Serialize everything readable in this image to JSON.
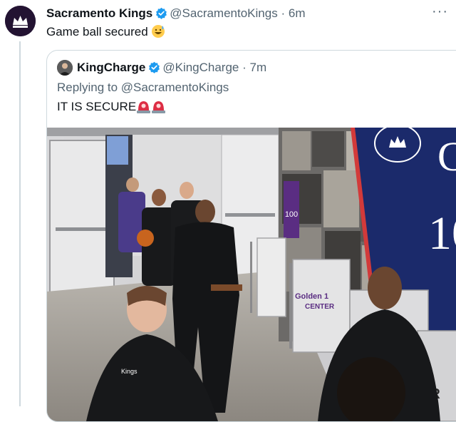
{
  "tweet": {
    "author_name": "Sacramento Kings",
    "author_handle": "@SacramentoKings",
    "separator": "·",
    "time": "6m",
    "text": "Game ball secured",
    "more_label": "···"
  },
  "quoted_tweet": {
    "author_name": "KingCharge",
    "author_handle": "@KingCharge",
    "separator": "·",
    "time": "7m",
    "replying_prefix": "Replying to",
    "replying_handle": "@SacramentoKings",
    "text": "IT IS SECURE"
  },
  "media": {
    "arena_banner_text": "100",
    "arena_sign_text": "Golden 1",
    "center_text": "CENTER",
    "shirt_text": "Kings",
    "side_text": "ER"
  },
  "colors": {
    "verified_blue": "#1d9bf0",
    "handle_gray": "#536471",
    "kings_purple": "#5a2d82",
    "banner_navy": "#1b2a6b"
  },
  "icons": {
    "verified": "verified-badge-icon",
    "more": "more-options-icon",
    "emoji_sweat": "grinning-sweat-emoji",
    "emoji_siren": "police-light-emoji"
  }
}
